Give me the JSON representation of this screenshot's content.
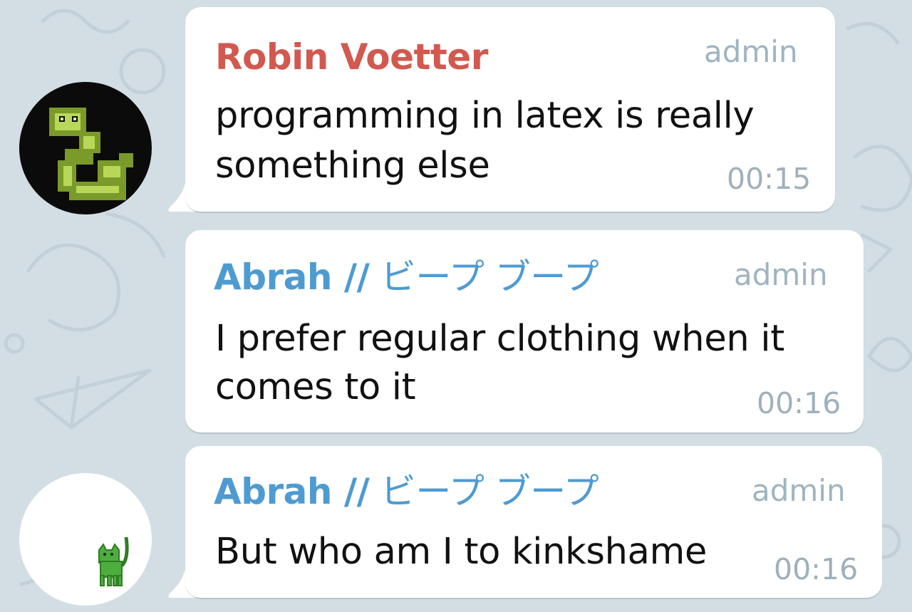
{
  "colors": {
    "background": "#d3dee4",
    "bubble": "#ffffff",
    "sender_red": "#d2594f",
    "sender_blue": "#4e9bd1",
    "meta_gray": "#9fb4c2"
  },
  "messages": [
    {
      "sender": "Robin Voetter",
      "sender_suffix": "",
      "role": "admin",
      "lines": [
        "programming in latex is really",
        "something else"
      ],
      "time": "00:15",
      "avatar_icon": "pixel-snake-icon"
    },
    {
      "sender": "Abrah //",
      "sender_suffix": " ビープ ブープ",
      "role": "admin",
      "lines": [
        "I prefer regular clothing when it",
        "comes to it"
      ],
      "time": "00:16"
    },
    {
      "sender": "Abrah //",
      "sender_suffix": " ビープ ブープ",
      "role": "admin",
      "lines": [
        "But who am I to kinkshame"
      ],
      "time": "00:16",
      "avatar_icon": "green-cat-icon"
    }
  ]
}
